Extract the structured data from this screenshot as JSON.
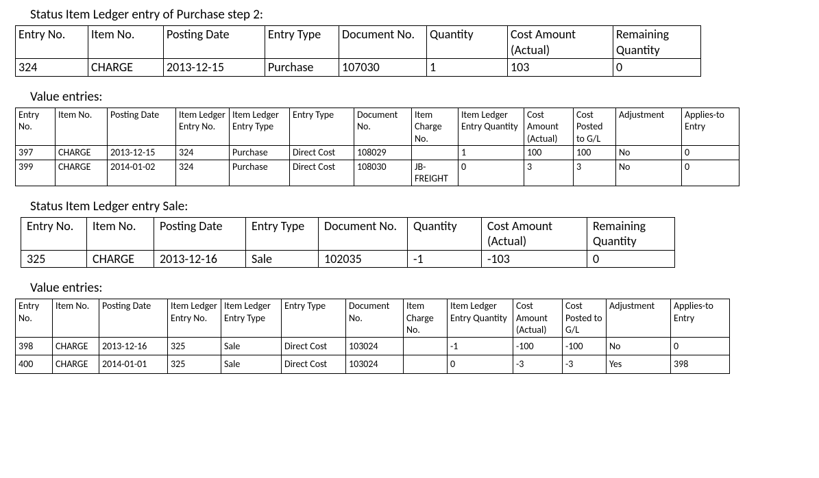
{
  "section1": {
    "title": "Status Item Ledger entry of Purchase step 2:",
    "headers": [
      "Entry No.",
      "Item No.",
      "Posting Date",
      "Entry Type",
      "Document No.",
      "Quantity",
      "Cost Amount (Actual)",
      "Remaining Quantity"
    ],
    "rows": [
      [
        "324",
        "CHARGE",
        "2013-12-15",
        "Purchase",
        "107030",
        "1",
        "103",
        "0"
      ]
    ]
  },
  "section2": {
    "title": "Value entries:",
    "headers": [
      "Entry No.",
      "Item No.",
      "Posting Date",
      "Item Ledger Entry No.",
      "Item Ledger Entry Type",
      "Entry Type",
      "Document No.",
      "Item Charge No.",
      "Item Ledger Entry Quantity",
      "Cost Amount (Actual)",
      "Cost Posted to G/L",
      "Adjustment",
      "Applies-to Entry"
    ],
    "rows": [
      [
        "397",
        "CHARGE",
        "2013-12-15",
        "324",
        "Purchase",
        "Direct Cost",
        "108029",
        "",
        "1",
        "100",
        "100",
        "No",
        "0"
      ],
      [
        "399",
        "CHARGE",
        "2014-01-02",
        "324",
        "Purchase",
        "Direct Cost",
        "108030",
        "JB-FREIGHT",
        "0",
        "3",
        "3",
        "No",
        "0"
      ]
    ]
  },
  "section3": {
    "title": "Status Item Ledger entry Sale:",
    "headers": [
      "Entry No.",
      "Item No.",
      "Posting Date",
      "Entry Type",
      "Document No.",
      "Quantity",
      "Cost Amount (Actual)",
      "Remaining Quantity"
    ],
    "rows": [
      [
        "325",
        "CHARGE",
        "2013-12-16",
        "Sale",
        "102035",
        "-1",
        "-103",
        "0"
      ]
    ]
  },
  "section4": {
    "title": "Value entries:",
    "headers": [
      "Entry No.",
      "Item No.",
      "Posting Date",
      "Item Ledger Entry No.",
      "Item Ledger Entry Type",
      "Entry Type",
      "Document No.",
      "Item Charge No.",
      "Item Ledger Entry Quantity",
      "Cost Amount (Actual)",
      "Cost Posted to G/L",
      "Adjustment",
      "Applies-to Entry"
    ],
    "rows": [
      [
        "398",
        "CHARGE",
        "2013-12-16",
        "325",
        "Sale",
        "Direct Cost",
        "103024",
        "",
        "-1",
        "-100",
        "-100",
        "No",
        "0"
      ],
      [
        "400",
        "CHARGE",
        "2014-01-01",
        "325",
        "Sale",
        "Direct Cost",
        "103024",
        "",
        "0",
        "-3",
        "-3",
        "Yes",
        "398"
      ]
    ]
  }
}
